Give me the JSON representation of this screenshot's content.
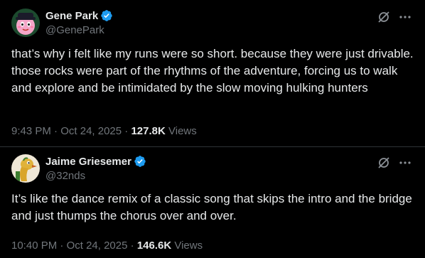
{
  "colors": {
    "background": "#000000",
    "text_primary": "#e7e9ea",
    "text_secondary": "#71767b",
    "verified_badge": "#1d9bf0",
    "divider": "#2f3336"
  },
  "posts": [
    {
      "author": {
        "name": "Gene Park",
        "handle": "@GenePark",
        "verified_icon": "verified-badge-icon",
        "avatar_icon": "avatar"
      },
      "icons": {
        "grok": "grok-icon",
        "more": "more-icon"
      },
      "text": "that’s why i felt like my runs were so short. because they were just drivable. those rocks were part of the rhythms of the adventure, forcing us to walk and explore and be intimidated by the slow moving hulking hunters",
      "time": "9:43 PM",
      "date": "Oct 24, 2025",
      "views_count": "127.8K",
      "views_label": "Views"
    },
    {
      "author": {
        "name": "Jaime Griesemer",
        "handle": "@32nds",
        "verified_icon": "verified-badge-icon",
        "avatar_icon": "avatar"
      },
      "icons": {
        "grok": "grok-icon",
        "more": "more-icon"
      },
      "text": "It’s like the dance remix of a classic song that skips the intro and the bridge and just thumps the chorus over and over.",
      "time": "10:40 PM",
      "date": "Oct 24, 2025",
      "views_count": "146.6K",
      "views_label": "Views"
    }
  ]
}
